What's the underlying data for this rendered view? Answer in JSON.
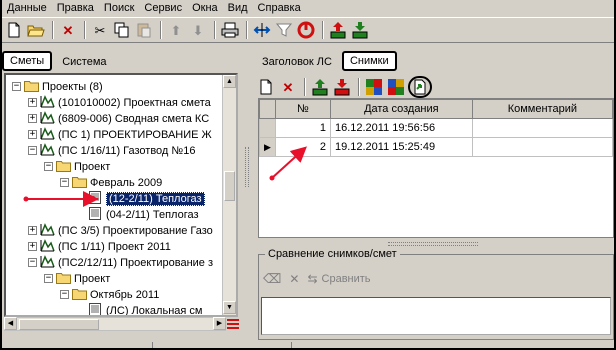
{
  "menu": [
    "Данные",
    "Правка",
    "Поиск",
    "Сервис",
    "Окна",
    "Вид",
    "Справка"
  ],
  "left_tabs": [
    "Сметы",
    "Система"
  ],
  "tree": [
    {
      "label": "Проекты (8)",
      "pm": "−",
      "icon": "folder-icon"
    },
    {
      "label": "(101010002) Проектная смета",
      "pm": "+",
      "icon": "estimate-icon"
    },
    {
      "label": "(6809-006) Сводная смета КС",
      "pm": "+",
      "icon": "estimate-icon"
    },
    {
      "label": "(ПС 1) ПРОЕКТИРОВАНИЕ Ж",
      "pm": "+",
      "icon": "estimate-icon"
    },
    {
      "label": "(ПС 1/16/11) Газотвод №16",
      "pm": "−",
      "icon": "estimate-icon"
    },
    {
      "label": "Проект",
      "pm": "−",
      "icon": "folder-icon"
    },
    {
      "label": "Февраль 2009",
      "pm": "−",
      "icon": "folder-icon"
    },
    {
      "label": "(12-2/11) Теплогаз",
      "pm": "",
      "icon": "document-icon"
    },
    {
      "label": "(04-2/11) Теплогаз",
      "pm": "",
      "icon": "document-icon"
    },
    {
      "label": "(ПС 3/5) Проектирование Газо",
      "pm": "+",
      "icon": "estimate-icon"
    },
    {
      "label": "(ПС 1/11) Проект 2011",
      "pm": "+",
      "icon": "estimate-icon"
    },
    {
      "label": "(ПС2/12/11) Проектирование з",
      "pm": "−",
      "icon": "estimate-icon"
    },
    {
      "label": "Проект",
      "pm": "−",
      "icon": "folder-icon"
    },
    {
      "label": "Октябрь 2011",
      "pm": "−",
      "icon": "folder-icon"
    },
    {
      "label": "(ЛС) Локальная см",
      "pm": "",
      "icon": "document-icon"
    }
  ],
  "right_tabs": [
    "Заголовок ЛС",
    "Снимки"
  ],
  "grid": {
    "columns": [
      "№",
      "Дата создания",
      "Комментарий"
    ],
    "rows": [
      {
        "num": "1",
        "date": "16.12.2011 19:56:56",
        "comment": ""
      },
      {
        "num": "2",
        "date": "19.12.2011 15:25:49",
        "comment": ""
      }
    ]
  },
  "compare": {
    "title": "Сравнение снимков/смет",
    "compare_label": "Сравнить"
  },
  "colors": {
    "arrow": "#e8102a",
    "selection": "#0a246a",
    "panel": "#d4d0c8"
  }
}
